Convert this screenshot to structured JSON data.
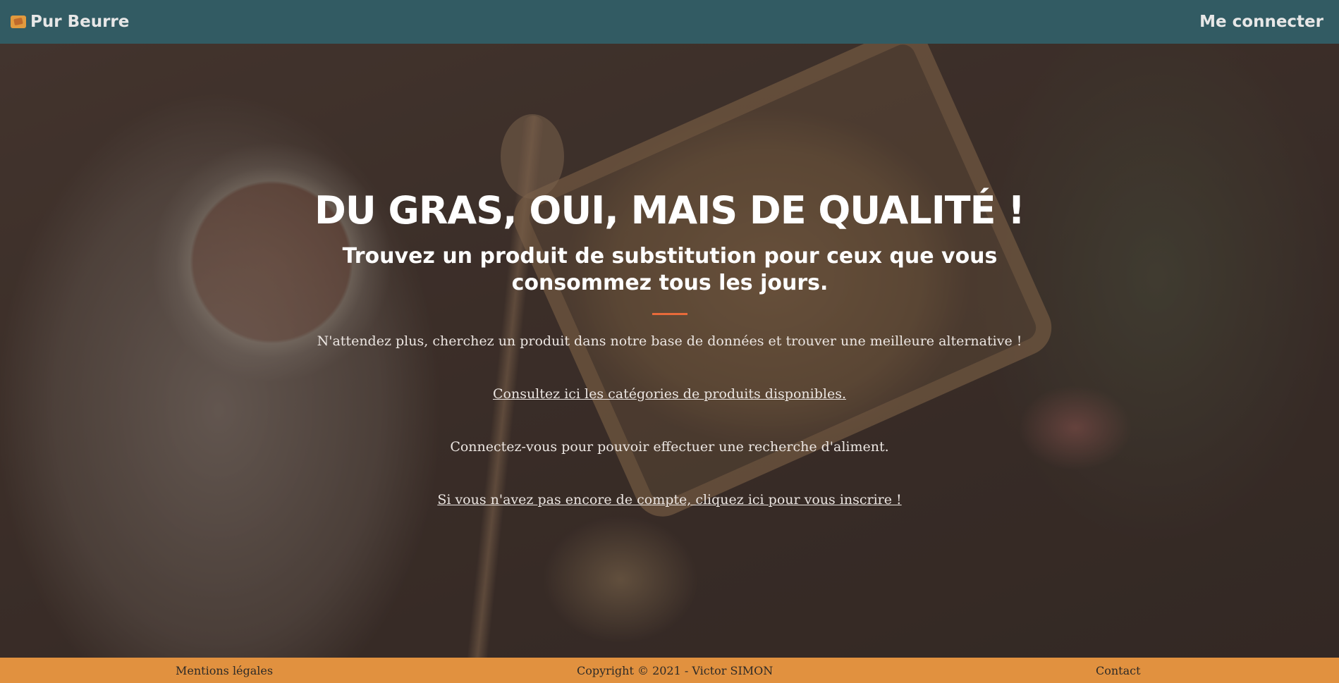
{
  "navbar": {
    "brand": "Pur Beurre",
    "brand_icon": "pur-beurre-logo-icon",
    "login_label": "Me connecter",
    "background": "#325b63"
  },
  "hero": {
    "headline": "DU GRAS, OUI, MAIS DE QUALITÉ !",
    "subhead": "Trouvez un produit de substitution pour ceux que vous consommez tous les jours.",
    "intro": "N'attendez plus, cherchez un produit dans notre base de données et trouver une meilleure alternative !",
    "categories_link": "Consultez ici les catégories de produits disponibles.",
    "login_prompt": "Connectez-vous pour pouvoir effectuer une recherche d'aliment.",
    "signup_link": "Si vous n'avez pas encore de compte, cliquez ici pour vous inscrire !",
    "divider_color": "#e86a3a"
  },
  "footer": {
    "legal": "Mentions légales",
    "copyright": "Copyright © 2021 - Victor SIMON",
    "contact": "Contact",
    "background": "#e1913f"
  }
}
